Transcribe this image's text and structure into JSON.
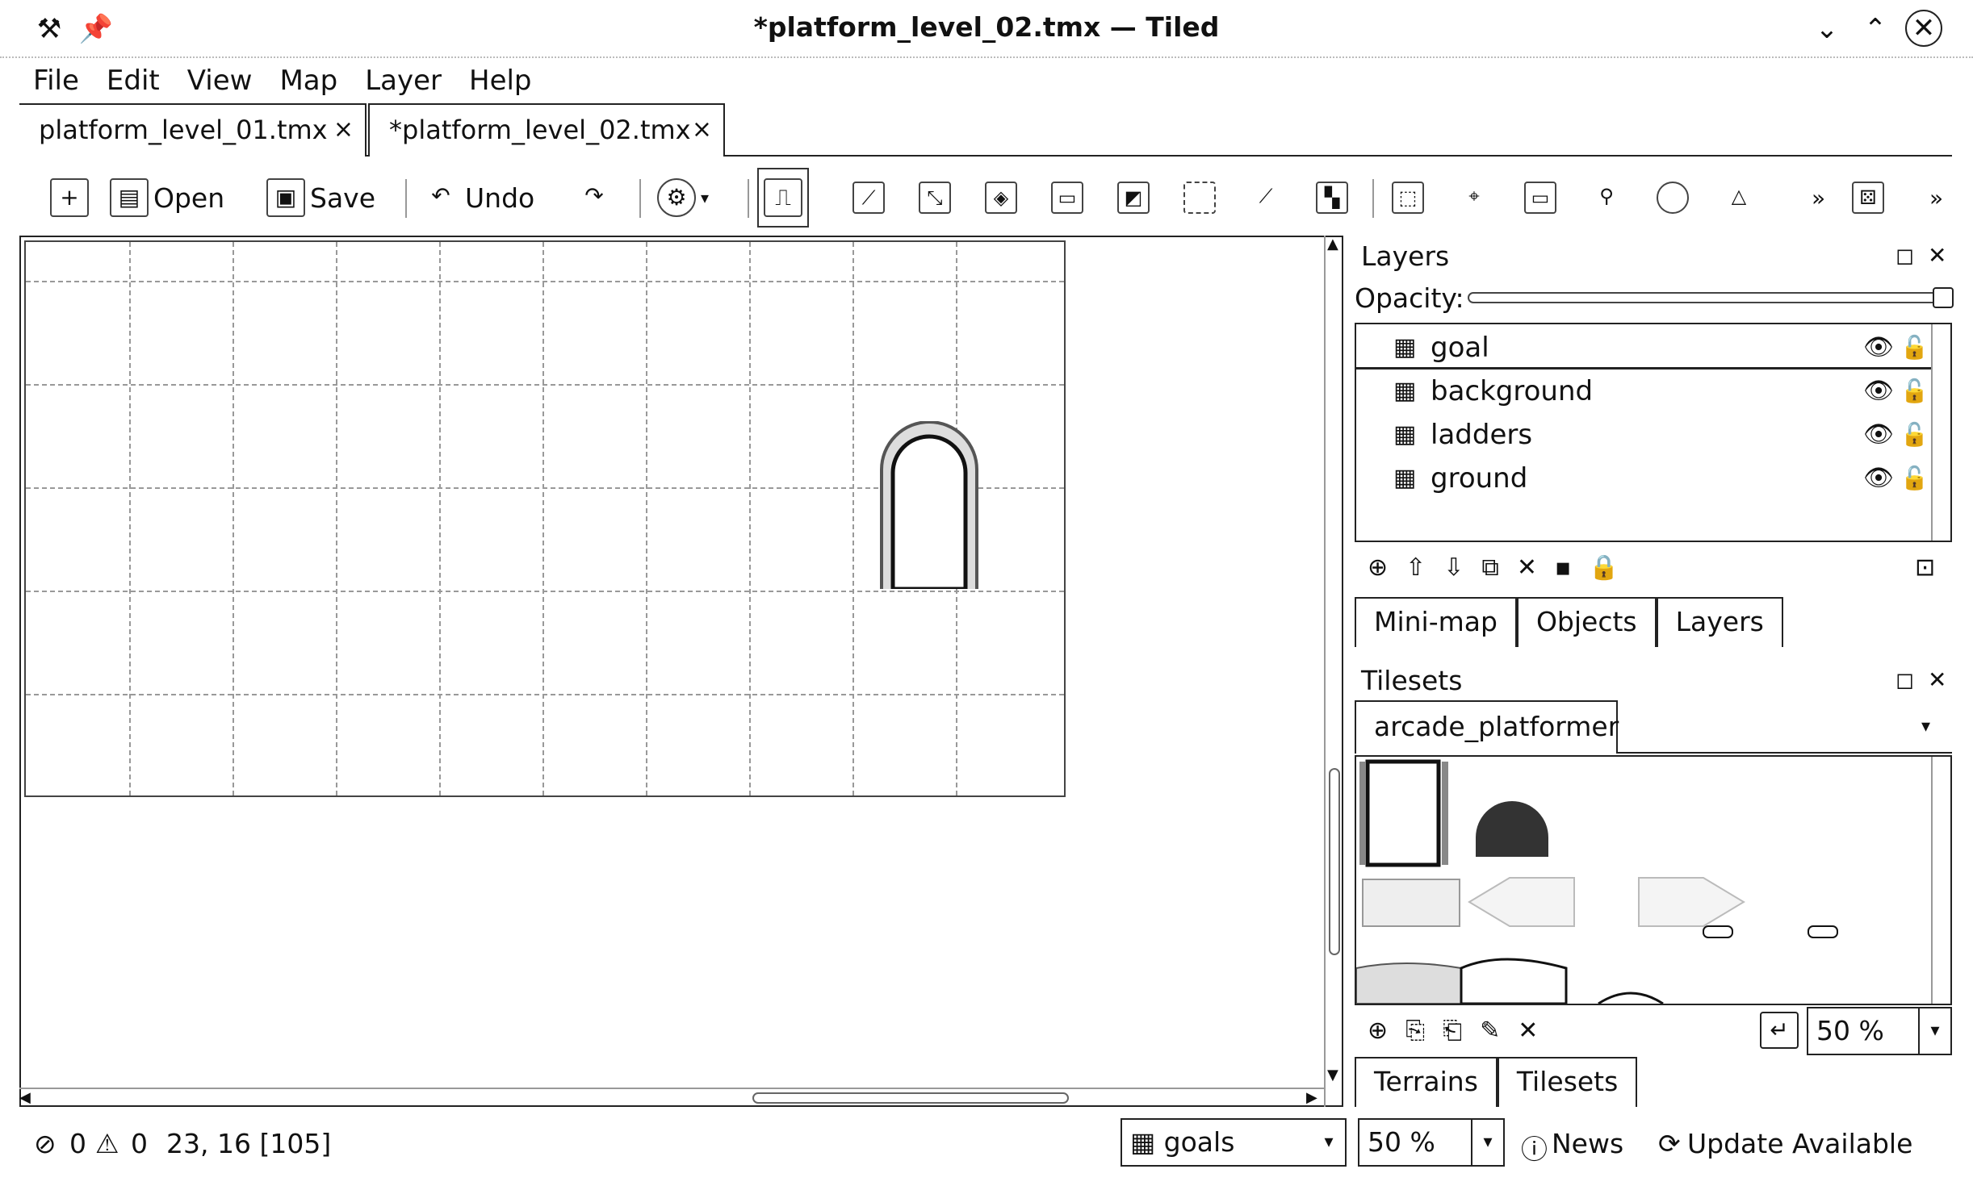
{
  "window": {
    "title": "*platform_level_02.tmx — Tiled",
    "app_icon": "tiled-app-icon",
    "pin_icon": "pin-icon",
    "controls": [
      "minimize-icon",
      "maximize-icon",
      "close-icon"
    ]
  },
  "menu": {
    "items": [
      {
        "label": "File"
      },
      {
        "label": "Edit"
      },
      {
        "label": "View"
      },
      {
        "label": "Map"
      },
      {
        "label": "Layer"
      },
      {
        "label": "Help"
      }
    ]
  },
  "tabs": [
    {
      "label": "platform_level_01.tmx",
      "close": "×"
    },
    {
      "label": "*platform_level_02.tmx",
      "close": "×"
    }
  ],
  "toolbar": {
    "open_label": "Open",
    "save_label": "Save",
    "undo_label": "Undo",
    "overflow": "»"
  },
  "layers_panel": {
    "title": "Layers",
    "opacity_label": "Opacity:",
    "opacity_value": 1.0,
    "layers": [
      {
        "name": "goal",
        "selected": true
      },
      {
        "name": "background",
        "selected": false
      },
      {
        "name": "ladders",
        "selected": false
      },
      {
        "name": "ground",
        "selected": false
      }
    ],
    "tabs": [
      {
        "label": "Mini-map"
      },
      {
        "label": "Objects"
      },
      {
        "label": "Layers"
      }
    ]
  },
  "tilesets_panel": {
    "title": "Tilesets",
    "tileset_name": "arcade_platformer",
    "zoom": "50 %",
    "tabs": [
      {
        "label": "Terrains"
      },
      {
        "label": "Tilesets"
      }
    ]
  },
  "status": {
    "errors": "0",
    "warnings": "0",
    "coords": "23, 16 [105]",
    "layer_combo": "goals",
    "zoom_combo": "50 %",
    "news": "News",
    "update": "Update Available"
  }
}
